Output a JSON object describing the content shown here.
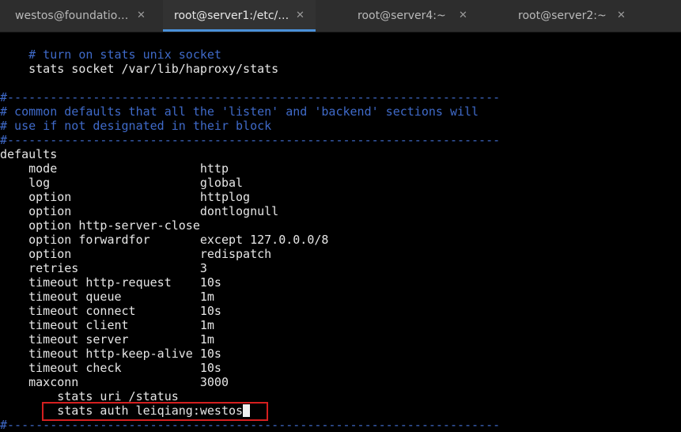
{
  "tabs": [
    {
      "title": "westos@foundatio…",
      "active": false
    },
    {
      "title": "root@server1:/etc/…",
      "active": true
    },
    {
      "title": "root@server4:~",
      "active": false
    },
    {
      "title": "root@server2:~",
      "active": false
    }
  ],
  "close_glyph": "✕",
  "terminal": {
    "lines": [
      {
        "text": "    # turn on stats unix socket",
        "type": "comment"
      },
      {
        "text": "    stats socket /var/lib/haproxy/stats",
        "type": "normal"
      },
      {
        "text": "",
        "type": "normal"
      },
      {
        "text": "#---------------------------------------------------------------------",
        "type": "comment"
      },
      {
        "text": "# common defaults that all the 'listen' and 'backend' sections will",
        "type": "comment"
      },
      {
        "text": "# use if not designated in their block",
        "type": "comment"
      },
      {
        "text": "#---------------------------------------------------------------------",
        "type": "comment"
      },
      {
        "text": "defaults",
        "type": "normal"
      },
      {
        "text": "    mode                    http",
        "type": "normal"
      },
      {
        "text": "    log                     global",
        "type": "normal"
      },
      {
        "text": "    option                  httplog",
        "type": "normal"
      },
      {
        "text": "    option                  dontlognull",
        "type": "normal"
      },
      {
        "text": "    option http-server-close",
        "type": "normal"
      },
      {
        "text": "    option forwardfor       except 127.0.0.0/8",
        "type": "normal"
      },
      {
        "text": "    option                  redispatch",
        "type": "normal"
      },
      {
        "text": "    retries                 3",
        "type": "normal"
      },
      {
        "text": "    timeout http-request    10s",
        "type": "normal"
      },
      {
        "text": "    timeout queue           1m",
        "type": "normal"
      },
      {
        "text": "    timeout connect         10s",
        "type": "normal"
      },
      {
        "text": "    timeout client          1m",
        "type": "normal"
      },
      {
        "text": "    timeout server          1m",
        "type": "normal"
      },
      {
        "text": "    timeout http-keep-alive 10s",
        "type": "normal"
      },
      {
        "text": "    timeout check           10s",
        "type": "normal"
      },
      {
        "text": "    maxconn                 3000",
        "type": "normal"
      },
      {
        "text": "        stats uri /status",
        "type": "normal"
      },
      {
        "text": "        stats auth leiqiang:westos",
        "type": "normal",
        "cursor": true
      },
      {
        "text": "#---------------------------------------------------------------------",
        "type": "comment"
      }
    ]
  },
  "colors": {
    "background": "#000000",
    "text": "#e6e6e6",
    "comment": "#3f6ac9",
    "tab_accent": "#4a90d9",
    "highlight_border": "#d51f1f"
  }
}
